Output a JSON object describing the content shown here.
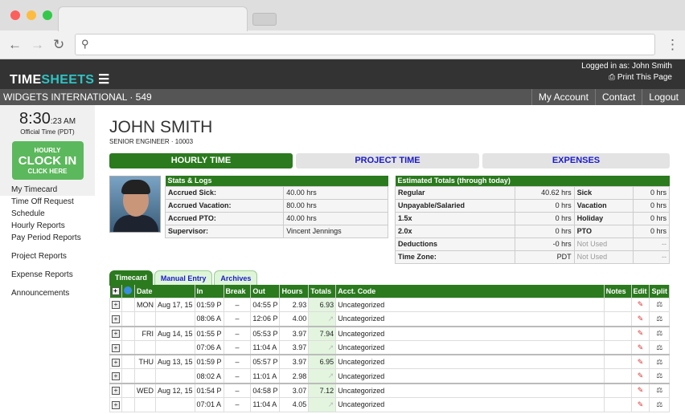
{
  "header": {
    "logo": "TIMESHEETS",
    "logged_in": "Logged in as: John Smith",
    "print": "Print This Page",
    "company": "WIDGETS INTERNATIONAL · 549",
    "nav": [
      "My Account",
      "Contact",
      "Logout"
    ]
  },
  "sidebar": {
    "time": "8:30",
    "seconds": ":23 AM",
    "official": "Official Time (PDT)",
    "clockin": {
      "top": "HOURLY",
      "main": "CLOCK IN",
      "sub": "CLICK HERE"
    },
    "links": [
      "My Timecard",
      "Time Off Request",
      "Schedule",
      "Hourly Reports",
      "Pay Period Reports"
    ],
    "links2": [
      "Project Reports"
    ],
    "links3": [
      "Expense Reports"
    ],
    "links4": [
      "Announcements"
    ]
  },
  "user": {
    "name": "JOHN SMITH",
    "title": "SENIOR ENGINEER ·  10003"
  },
  "tabs": [
    "HOURLY TIME",
    "PROJECT TIME",
    "EXPENSES"
  ],
  "stats": {
    "title": "Stats & Logs",
    "rows": [
      [
        "Accrued Sick:",
        "40.00 hrs"
      ],
      [
        "Accrued Vacation:",
        "80.00 hrs"
      ],
      [
        "Accrued PTO:",
        "40.00 hrs"
      ],
      [
        "Supervisor:",
        "Vincent Jennings"
      ]
    ]
  },
  "estimated": {
    "title": "Estimated Totals (through today)",
    "rows": [
      [
        "Regular",
        "40.62 hrs",
        "Sick",
        "0 hrs"
      ],
      [
        "Unpayable/Salaried",
        "0 hrs",
        "Vacation",
        "0 hrs"
      ],
      [
        "1.5x",
        "0 hrs",
        "Holiday",
        "0 hrs"
      ],
      [
        "2.0x",
        "0 hrs",
        "PTO",
        "0 hrs"
      ],
      [
        "Deductions",
        "-0 hrs",
        "Not Used",
        "--"
      ],
      [
        "Time Zone:",
        "PDT",
        "Not Used",
        "--"
      ]
    ]
  },
  "timecard": {
    "tabs": [
      "Timecard",
      "Manual Entry",
      "Archives"
    ],
    "headers": [
      "Date",
      "In",
      "Break",
      "Out",
      "Hours",
      "Totals",
      "Acct. Code",
      "Notes",
      "Edit",
      "Split"
    ],
    "rows": [
      [
        "MON",
        "Aug 17, 15",
        "01:59 P",
        "–",
        "04:55 P",
        "2.93",
        "6.93",
        "Uncategorized"
      ],
      [
        "",
        "",
        "08:06 A",
        "–",
        "12:06 P",
        "4.00",
        "",
        "Uncategorized"
      ],
      [
        "FRI",
        "Aug 14, 15",
        "01:55 P",
        "–",
        "05:53 P",
        "3.97",
        "7.94",
        "Uncategorized"
      ],
      [
        "",
        "",
        "07:06 A",
        "–",
        "11:04 A",
        "3.97",
        "",
        "Uncategorized"
      ],
      [
        "THU",
        "Aug 13, 15",
        "01:59 P",
        "–",
        "05:57 P",
        "3.97",
        "6.95",
        "Uncategorized"
      ],
      [
        "",
        "",
        "08:02 A",
        "–",
        "11:01 A",
        "2.98",
        "",
        "Uncategorized"
      ],
      [
        "WED",
        "Aug 12, 15",
        "01:54 P",
        "–",
        "04:58 P",
        "3.07",
        "7.12",
        "Uncategorized"
      ],
      [
        "",
        "",
        "07:01 A",
        "–",
        "11:04 A",
        "4.05",
        "",
        "Uncategorized"
      ]
    ]
  }
}
